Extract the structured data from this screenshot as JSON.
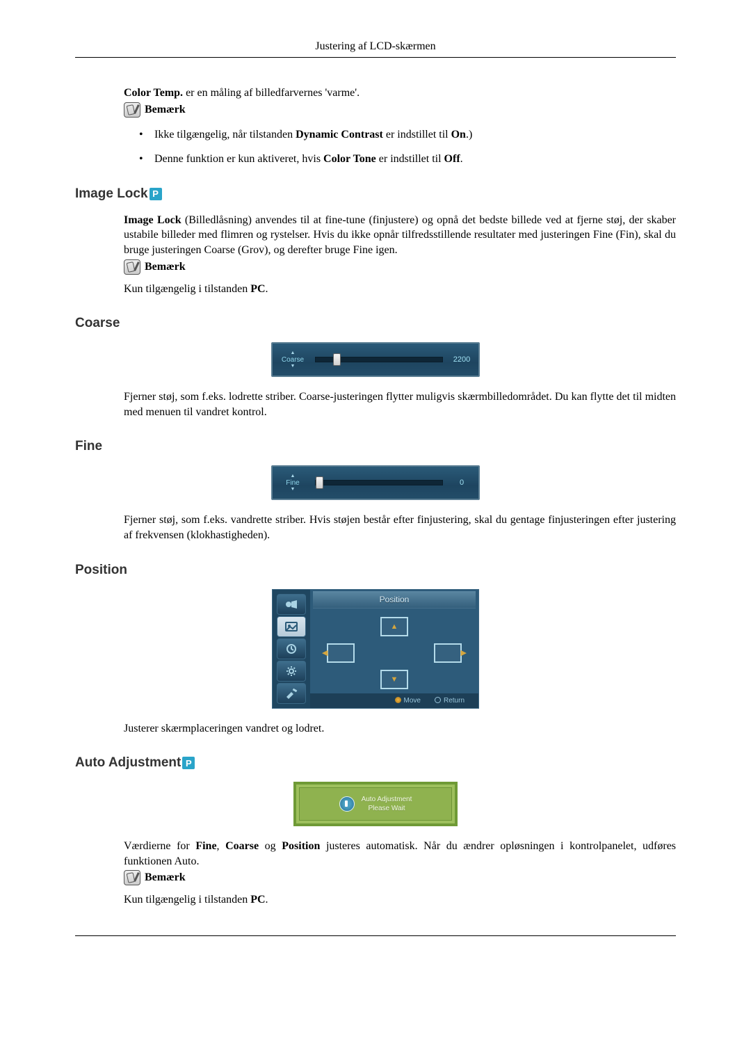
{
  "header": {
    "title": "Justering af LCD-skærmen"
  },
  "note_label": "Bemærk",
  "color_temp": {
    "lead_bold": "Color Temp.",
    "lead_rest": " er en måling af billedfarvernes 'varme'.",
    "bullets": [
      {
        "pre": "Ikke tilgængelig, når tilstanden ",
        "b1": "Dynamic Contrast",
        "mid": " er indstillet til ",
        "b2": "On",
        "post": ".)"
      },
      {
        "pre": "Denne funktion er kun aktiveret, hvis ",
        "b1": "Color Tone",
        "mid": " er indstillet til ",
        "b2": "Off",
        "post": "."
      }
    ]
  },
  "image_lock": {
    "title": "Image Lock",
    "para_lead": "Image Lock",
    "para_rest": " (Billedlåsning) anvendes til at fine-tune (finjustere) og opnå det bedste billede ved at fjerne støj, der skaber ustabile billeder med flimren og rystelser. Hvis du ikke opnår tilfredsstillende resultater med justeringen Fine (Fin), skal du bruge justeringen Coarse (Grov), og derefter bruge Fine igen.",
    "note_pre": "Kun tilgængelig i tilstanden ",
    "note_b": "PC",
    "note_post": "."
  },
  "coarse": {
    "title": "Coarse",
    "slider_label": "Coarse",
    "value": "2200",
    "thumb_pct": 14,
    "desc": "Fjerner støj, som f.eks. lodrette striber. Coarse-justeringen flytter muligvis skærmbilledområdet. Du kan flytte det til midten med menuen til vandret kontrol."
  },
  "fine": {
    "title": "Fine",
    "slider_label": "Fine",
    "value": "0",
    "thumb_pct": 0,
    "desc": "Fjerner støj, som f.eks. vandrette striber. Hvis støjen består efter finjustering, skal du gentage finjusteringen efter justering af frekvensen (klokhastigheden)."
  },
  "position": {
    "title": "Position",
    "panel_title": "Position",
    "move": "Move",
    "ret": "Return",
    "desc": "Justerer skærmplaceringen vandret og lodret.",
    "side_icons": [
      "input-icon",
      "picture-icon",
      "clock-icon",
      "gear-icon",
      "tools-icon"
    ]
  },
  "auto": {
    "title": "Auto Adjustment",
    "line1": "Auto Adjustment",
    "line2": "Please Wait",
    "para_pre": "Værdierne for ",
    "b1": "Fine",
    "c1": ", ",
    "b2": "Coarse",
    "c2": " og ",
    "b3": "Position",
    "para_post": " justeres automatisk. Når du ændrer opløsningen i kontrolpanelet, udføres funktionen Auto.",
    "note_pre": "Kun tilgængelig i tilstanden ",
    "note_b": "PC",
    "note_post": "."
  }
}
